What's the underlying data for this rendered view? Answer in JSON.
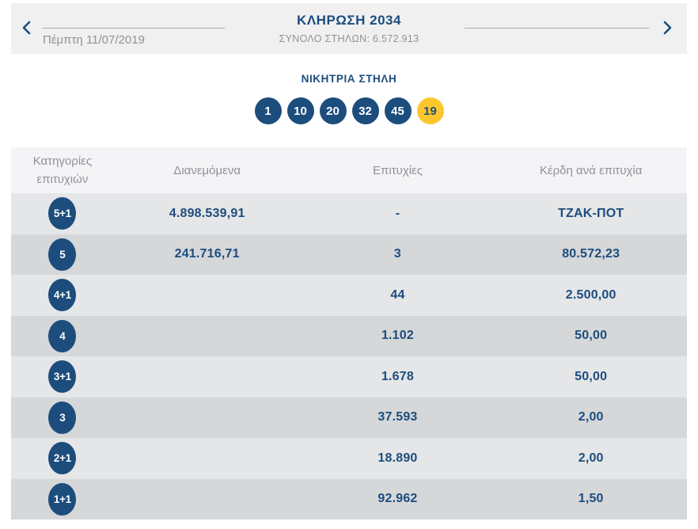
{
  "colors": {
    "accent_blue": "#1c4d7d",
    "joker_yellow": "#fcc72c",
    "muted_gray": "#8f9296",
    "row_light": "#e5e6e8",
    "row_dark": "#d5d7d9",
    "table_header_bg": "#f4f4f6",
    "topbar_bg": "#f0f0f1"
  },
  "topbar": {
    "prev_icon": "chevron-left",
    "next_icon": "chevron-right",
    "date": "Πέμπτη 11/07/2019",
    "title": "ΚΛΗΡΩΣΗ 2034",
    "total_columns": "ΣΥΝΟΛΟ ΣΤΗΛΩΝ: 6.572.913"
  },
  "winning_column": {
    "title": "ΝΙΚΗΤΡΙΑ ΣΤΗΛΗ",
    "numbers": [
      "1",
      "10",
      "20",
      "32",
      "45"
    ],
    "joker_number": "19"
  },
  "results_table": {
    "headers": {
      "category": "Κατηγορίες επιτυχιών",
      "distributed": "Διανεμόμενα",
      "hits": "Επιτυχίες",
      "prize_per_hit": "Κέρδη ανά επιτυχία"
    },
    "rows": [
      {
        "category": "5+1",
        "distributed": "4.898.539,91",
        "hits": "-",
        "prize_per_hit": "ΤΖΑΚ-ΠΟΤ"
      },
      {
        "category": "5",
        "distributed": "241.716,71",
        "hits": "3",
        "prize_per_hit": "80.572,23"
      },
      {
        "category": "4+1",
        "distributed": "",
        "hits": "44",
        "prize_per_hit": "2.500,00"
      },
      {
        "category": "4",
        "distributed": "",
        "hits": "1.102",
        "prize_per_hit": "50,00"
      },
      {
        "category": "3+1",
        "distributed": "",
        "hits": "1.678",
        "prize_per_hit": "50,00"
      },
      {
        "category": "3",
        "distributed": "",
        "hits": "37.593",
        "prize_per_hit": "2,00"
      },
      {
        "category": "2+1",
        "distributed": "",
        "hits": "18.890",
        "prize_per_hit": "2,00"
      },
      {
        "category": "1+1",
        "distributed": "",
        "hits": "92.962",
        "prize_per_hit": "1,50"
      }
    ]
  }
}
